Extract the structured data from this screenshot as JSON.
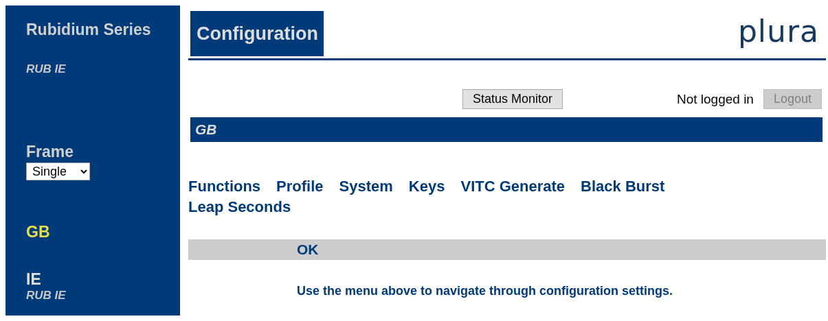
{
  "sidebar": {
    "series_title": "Rubidium Series",
    "series_subtitle": "RUB IE",
    "frame": {
      "label": "Frame",
      "value": "Single"
    },
    "devices": [
      {
        "name": "GB",
        "selected": true
      },
      {
        "name": "IE",
        "subtitle": "RUB IE",
        "selected": false
      }
    ]
  },
  "header": {
    "title": "Configuration",
    "logo": "plura"
  },
  "toolbar": {
    "status_button": "Status Monitor",
    "login_status": "Not logged in",
    "logout_button": {
      "label": "Logout",
      "disabled": true
    }
  },
  "device_bar": "GB",
  "menu": [
    "Functions",
    "Profile",
    "System",
    "Keys",
    "VITC Generate",
    "Black Burst",
    "Leap Seconds"
  ],
  "status_bar": "OK",
  "message": "Use the menu above to navigate through configuration settings."
}
